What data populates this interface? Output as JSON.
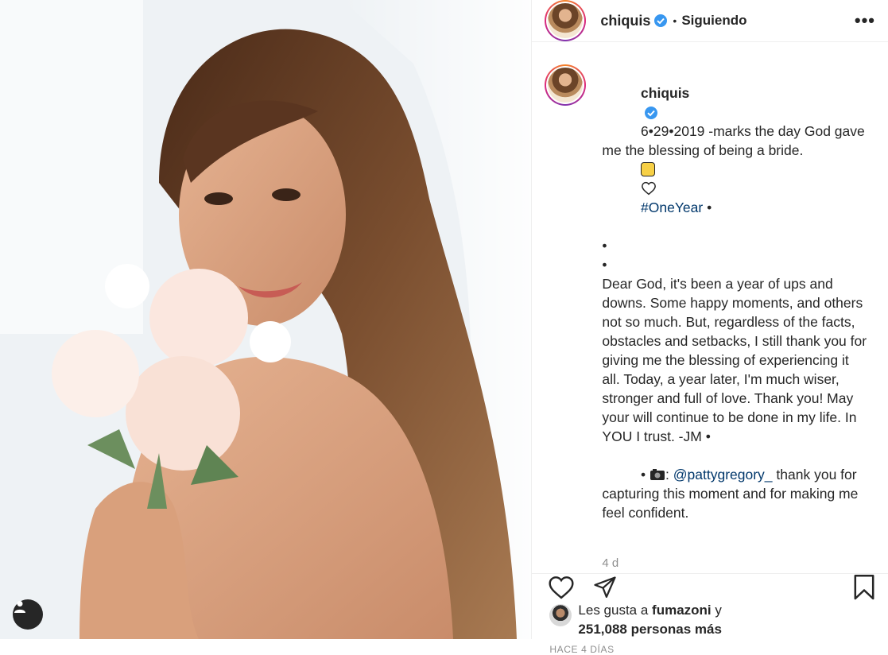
{
  "post": {
    "author": {
      "username": "chiquis",
      "verified": true
    },
    "header": {
      "separator": "•",
      "follow_state": "Siguiendo",
      "more_icon": "ellipsis-icon"
    },
    "caption": {
      "intro": "6•29•2019 -marks the day God gave me the blessing of being a bride.",
      "hashtag": "#OneYear",
      "after_hashtag": " •",
      "bullet1": "•",
      "bullet2": "•",
      "body": "Dear God, it's been a year of ups and downs. Some happy moments, and others not so much. But, regardless of the facts, obstacles and setbacks, I still thank you for giving me the blessing of experiencing it all. Today, a year later, I'm much wiser, stronger and full of love. Thank you! May your will continue to be done in my life. In YOU I trust. -JM •",
      "credit_prefix": "• ",
      "credit_colon": ": ",
      "mention": "@pattygregory_",
      "credit_text": " thank you for capturing this moment and for making me feel confident."
    },
    "relative_time": "4 d",
    "likes": {
      "prefix": "Les gusta a",
      "user": "fumazoni",
      "conjunction": "y",
      "count_text": "251,088 personas más"
    },
    "date_label": "HACE 4 DÍAS"
  },
  "colors": {
    "verified": "#3897f0",
    "link": "#00376b",
    "muted": "#8e8e8e"
  }
}
